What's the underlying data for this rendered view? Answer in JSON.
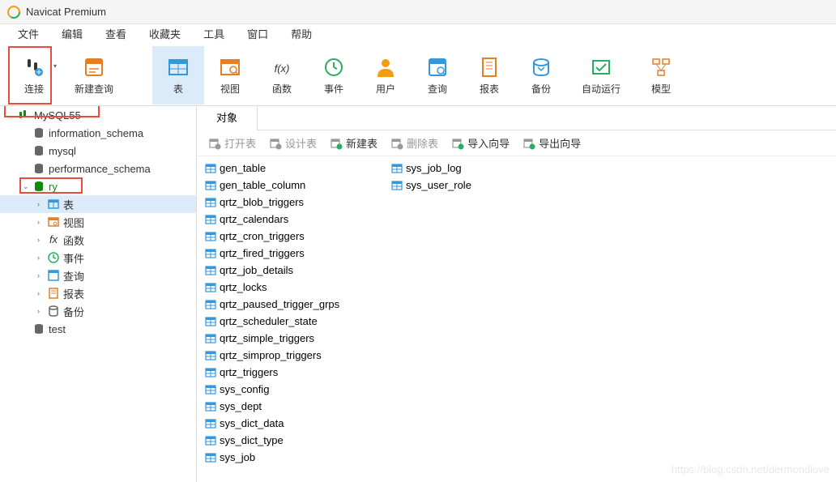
{
  "titlebar": {
    "text": "Navicat Premium"
  },
  "menubar": {
    "items": [
      "文件",
      "编辑",
      "查看",
      "收藏夹",
      "工具",
      "窗口",
      "帮助"
    ]
  },
  "toolbar": {
    "items": [
      {
        "label": "连接",
        "icon": "plug",
        "color": "#333",
        "highlighted": false,
        "dropdown": true,
        "redbox": true
      },
      {
        "label": "新建查询",
        "icon": "query",
        "color": "#e67e22",
        "highlighted": false
      },
      {
        "label": "表",
        "icon": "table",
        "color": "#3498db",
        "highlighted": true
      },
      {
        "label": "视图",
        "icon": "view",
        "color": "#e67e22",
        "highlighted": false
      },
      {
        "label": "函数",
        "icon": "fx",
        "color": "#333",
        "highlighted": false
      },
      {
        "label": "事件",
        "icon": "clock",
        "color": "#27ae60",
        "highlighted": false
      },
      {
        "label": "用户",
        "icon": "user",
        "color": "#f39c12",
        "highlighted": false
      },
      {
        "label": "查询",
        "icon": "query2",
        "color": "#3498db",
        "highlighted": false
      },
      {
        "label": "报表",
        "icon": "report",
        "color": "#e67e22",
        "highlighted": false
      },
      {
        "label": "备份",
        "icon": "backup",
        "color": "#3498db",
        "highlighted": false
      },
      {
        "label": "自动运行",
        "icon": "auto",
        "color": "#27ae60",
        "highlighted": false
      },
      {
        "label": "模型",
        "icon": "model",
        "color": "#e67e22",
        "highlighted": false
      }
    ]
  },
  "sidebar": {
    "nodes": [
      {
        "label": "MySQL55",
        "level": 0,
        "icon": "db-conn",
        "color": "#0e8a0e",
        "expand": "",
        "redbox": true
      },
      {
        "label": "information_schema",
        "level": 1,
        "icon": "db",
        "color": "#666",
        "expand": ""
      },
      {
        "label": "mysql",
        "level": 1,
        "icon": "db",
        "color": "#666",
        "expand": ""
      },
      {
        "label": "performance_schema",
        "level": 1,
        "icon": "db",
        "color": "#666",
        "expand": ""
      },
      {
        "label": "ry",
        "level": 1,
        "icon": "db-open",
        "color": "#0e8a0e",
        "expand": "v",
        "green": true,
        "redbox": true
      },
      {
        "label": "表",
        "level": 2,
        "icon": "table-s",
        "color": "#3498db",
        "expand": ">",
        "selected": true
      },
      {
        "label": "视图",
        "level": 2,
        "icon": "view-s",
        "color": "#e67e22",
        "expand": ">"
      },
      {
        "label": "函数",
        "level": 2,
        "icon": "fx-s",
        "color": "#333",
        "expand": ">"
      },
      {
        "label": "事件",
        "level": 2,
        "icon": "clock-s",
        "color": "#27ae60",
        "expand": ">"
      },
      {
        "label": "查询",
        "level": 2,
        "icon": "query-s",
        "color": "#3498db",
        "expand": ">"
      },
      {
        "label": "报表",
        "level": 2,
        "icon": "report-s",
        "color": "#e67e22",
        "expand": ">"
      },
      {
        "label": "备份",
        "level": 2,
        "icon": "backup-s",
        "color": "#666",
        "expand": ">"
      },
      {
        "label": "test",
        "level": 1,
        "icon": "db",
        "color": "#666",
        "expand": ""
      }
    ]
  },
  "content": {
    "tab": "对象",
    "actions": [
      {
        "label": "打开表",
        "enabled": false,
        "icon": "open"
      },
      {
        "label": "设计表",
        "enabled": false,
        "icon": "design"
      },
      {
        "label": "新建表",
        "enabled": true,
        "icon": "new",
        "accent": "#27ae60"
      },
      {
        "label": "删除表",
        "enabled": false,
        "icon": "delete"
      },
      {
        "label": "导入向导",
        "enabled": true,
        "icon": "import",
        "accent": "#27ae60"
      },
      {
        "label": "导出向导",
        "enabled": true,
        "icon": "export",
        "accent": "#27ae60"
      }
    ],
    "tables": [
      "gen_table",
      "gen_table_column",
      "qrtz_blob_triggers",
      "qrtz_calendars",
      "qrtz_cron_triggers",
      "qrtz_fired_triggers",
      "qrtz_job_details",
      "qrtz_locks",
      "qrtz_paused_trigger_grps",
      "qrtz_scheduler_state",
      "qrtz_simple_triggers",
      "qrtz_simprop_triggers",
      "qrtz_triggers",
      "sys_config",
      "sys_dept",
      "sys_dict_data",
      "sys_dict_type",
      "sys_job",
      "sys_job_log",
      "sys_user_role"
    ]
  },
  "watermark": "https://blog.csdn.net/dermondlove"
}
